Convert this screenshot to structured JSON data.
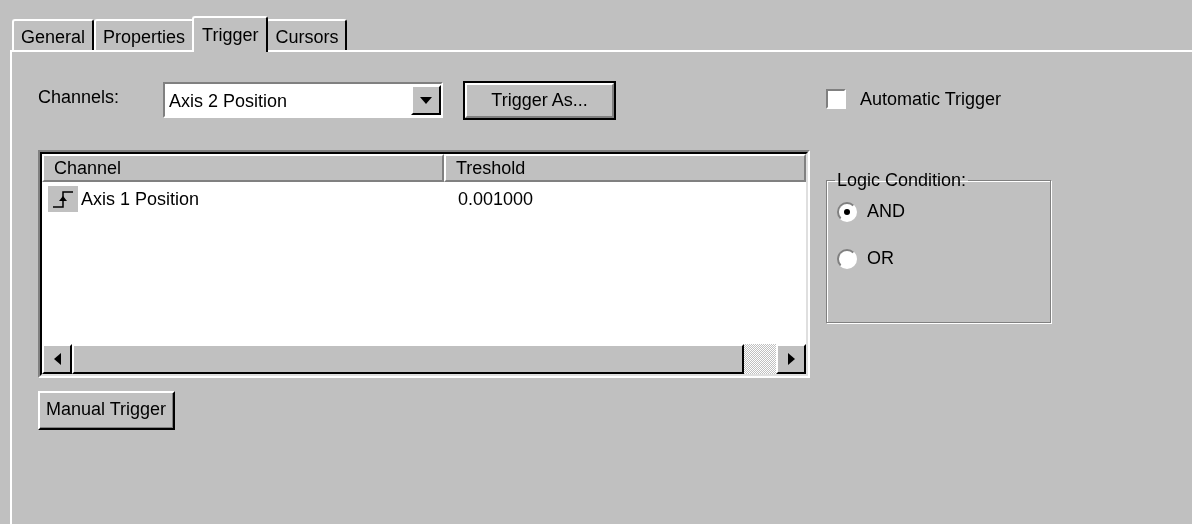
{
  "tabs": [
    {
      "label": "General",
      "selected": false
    },
    {
      "label": "Properties",
      "selected": false
    },
    {
      "label": "Trigger",
      "selected": true
    },
    {
      "label": "Cursors",
      "selected": false
    }
  ],
  "channels_field": {
    "label": "Channels:",
    "value": "Axis 2 Position"
  },
  "buttons": [
    {
      "label": "Trigger As...",
      "default": true
    },
    {
      "label": "Manual Trigger",
      "default": false
    }
  ],
  "automatic_trigger": {
    "label": "Automatic Trigger",
    "checked": false
  },
  "table": {
    "columns": [
      "Channel",
      "Treshold"
    ],
    "rows": [
      {
        "cells": [
          "Axis 1 Position",
          "0.001000"
        ]
      }
    ]
  },
  "logic_condition": {
    "title": "Logic Condition:",
    "options": [
      {
        "label": "AND",
        "selected": true
      },
      {
        "label": "OR",
        "selected": false
      }
    ]
  }
}
